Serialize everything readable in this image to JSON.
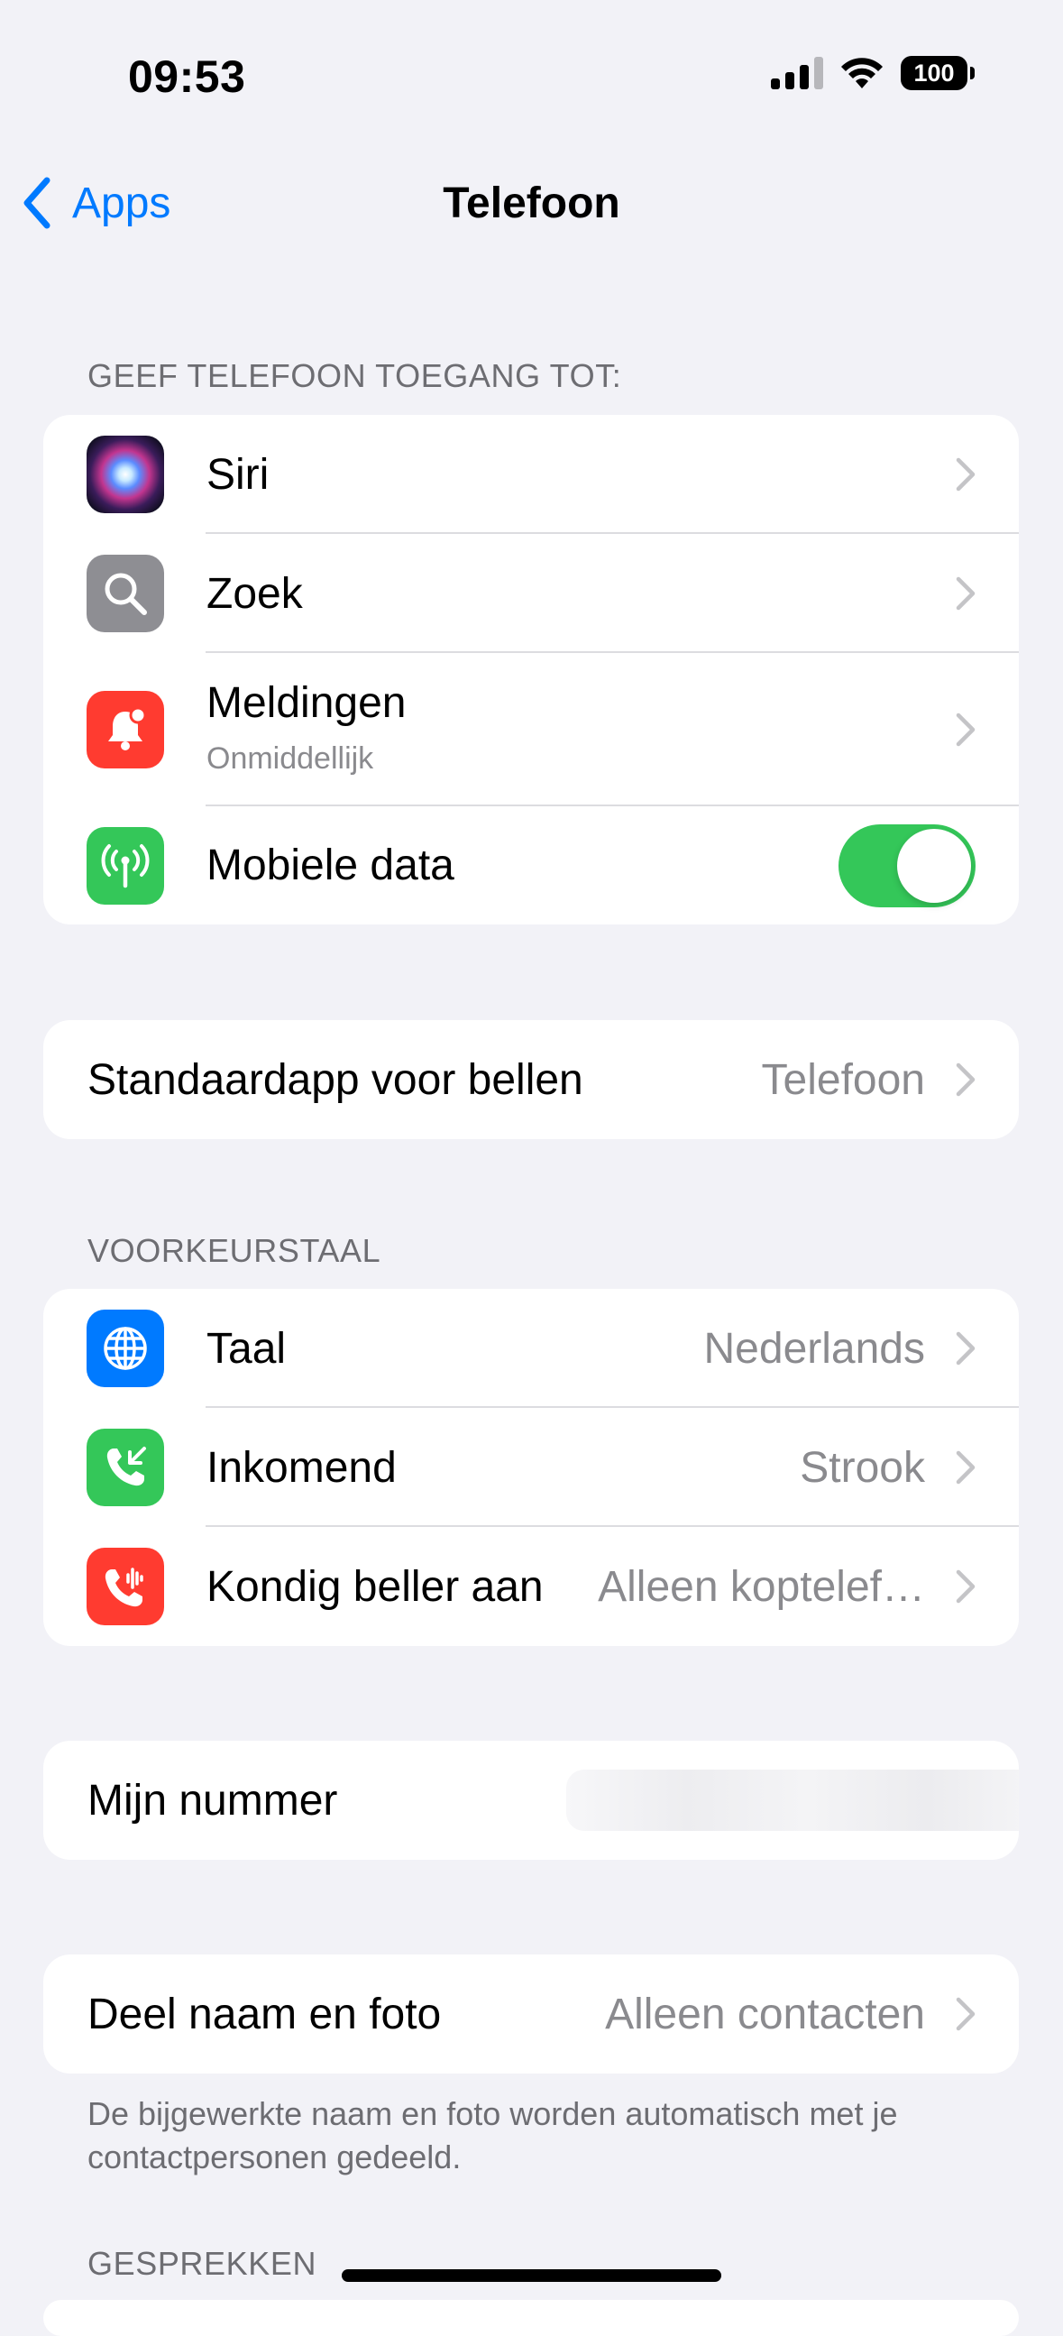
{
  "status_bar": {
    "time": "09:53",
    "battery": "100"
  },
  "nav": {
    "back_label": "Apps",
    "title": "Telefoon"
  },
  "section_access": {
    "header": "GEEF TELEFOON TOEGANG TOT:",
    "items": [
      {
        "label": "Siri",
        "icon": "siri-icon"
      },
      {
        "label": "Zoek",
        "icon": "search-icon"
      },
      {
        "label": "Meldingen",
        "sublabel": "Onmiddellijk",
        "icon": "notifications-icon"
      },
      {
        "label": "Mobiele data",
        "icon": "cellular-icon",
        "toggle_on": true
      }
    ]
  },
  "default_app": {
    "label": "Standaardapp voor bellen",
    "value": "Telefoon"
  },
  "section_language": {
    "header": "VOORKEURSTAAL",
    "items": [
      {
        "label": "Taal",
        "value": "Nederlands",
        "icon": "globe-icon"
      },
      {
        "label": "Inkomend",
        "value": "Strook",
        "icon": "incoming-call-icon"
      },
      {
        "label": "Kondig beller aan",
        "value": "Alleen koptelef…",
        "icon": "announce-calls-icon"
      }
    ]
  },
  "my_number": {
    "label": "Mijn nummer"
  },
  "share_name": {
    "label": "Deel naam en foto",
    "value": "Alleen contacten",
    "footer": "De bijgewerkte naam en foto worden automatisch met je contactpersonen gedeeld."
  },
  "section_calls": {
    "header": "GESPREKKEN"
  },
  "colors": {
    "accent": "#007AFF",
    "toggle_on": "#34C759",
    "search_icon_bg": "#8E8E93",
    "notifications_icon_bg": "#FF3B30",
    "cellular_icon_bg": "#34C759",
    "globe_icon_bg": "#007AFF",
    "incoming_icon_bg": "#34C759",
    "announce_icon_bg": "#FF3B30"
  }
}
